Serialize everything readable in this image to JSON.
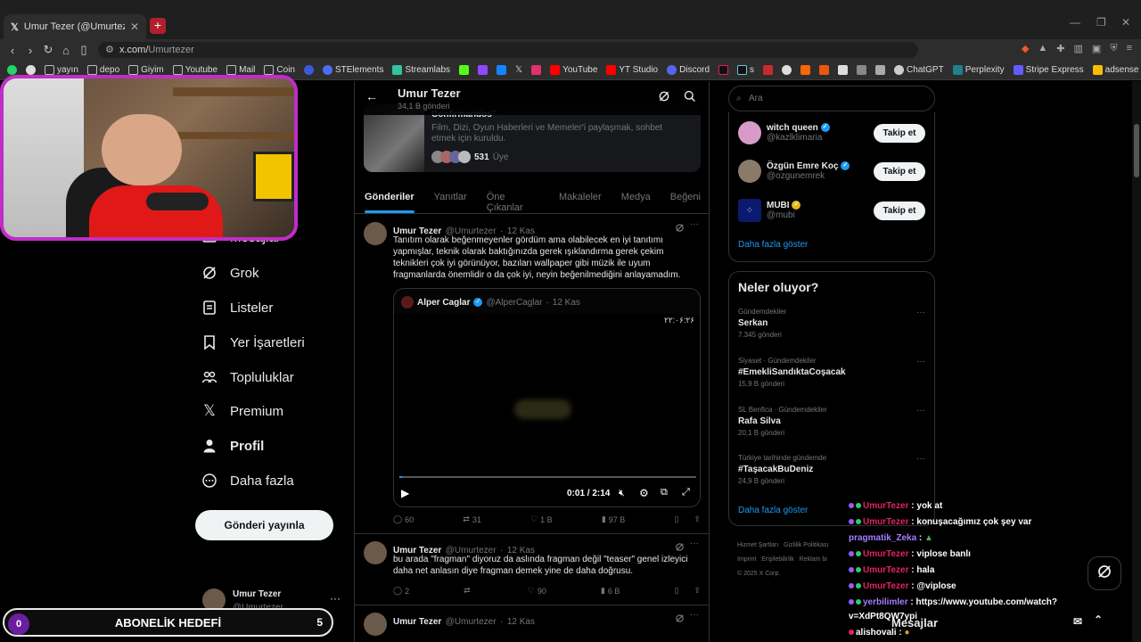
{
  "browser": {
    "tab_title": "Umur Tezer (@Umurtezer) / X",
    "url_prefix": "x.com/",
    "url_rest": "Umurtezer",
    "bookmarks": [
      "yayın",
      "depo",
      "Giyim",
      "Youtube",
      "Mail",
      "Coin",
      "STElements",
      "Streamlabs",
      "YouTube",
      "YT Studio",
      "Discord",
      "s",
      "ChatGPT",
      "Perplexity",
      "Stripe Express",
      "adsense"
    ],
    "colors": {
      "accent": "#1d9bf0",
      "webcam_border": "#c02dc8"
    }
  },
  "sidebar": {
    "items": [
      {
        "label": "Mesajlar",
        "icon": "envelope-icon"
      },
      {
        "label": "Grok",
        "icon": "grok-icon"
      },
      {
        "label": "Listeler",
        "icon": "list-icon"
      },
      {
        "label": "Yer İşaretleri",
        "icon": "bookmark-icon"
      },
      {
        "label": "Topluluklar",
        "icon": "people-icon"
      },
      {
        "label": "Premium",
        "icon": "x-logo-icon"
      },
      {
        "label": "Profil",
        "icon": "person-icon"
      },
      {
        "label": "Daha fazla",
        "icon": "more-circle-icon"
      }
    ],
    "post_button": "Gönderi yayınla",
    "account_name": "Umur Tezer",
    "account_handle": "@Umurtezer"
  },
  "profile_header": {
    "name": "Umur Tezer",
    "count": "34,1 B gönderi"
  },
  "community": {
    "title": "Confirmandos\"",
    "desc": "Film, Dizi, Oyun Haberleri ve Memeler'i paylaşmak, sohbet etmek için kuruldu.",
    "members_count": "531",
    "members_label": "Üye"
  },
  "tabs": [
    "Gönderiler",
    "Yanıtlar",
    "Öne Çıkanlar",
    "Makaleler",
    "Medya",
    "Beğeni"
  ],
  "tweets": [
    {
      "name": "Umur Tezer",
      "handle": "@Umurtezer",
      "date": "12 Kas",
      "text": "Tanıtım olarak beğenmeyenler gördüm ama olabilecek en iyi tanıtımı yapmışlar, teknik olarak baktığınızda gerek ışıklandırma gerek çekim teknikleri çok iyi görünüyor, bazıları wallpaper gibi müzik ile uyum fragmanlarda önemlidir o da çok iyi, neyin beğenilmediğini anlayamadım.",
      "quote": {
        "name": "Alper Caglar",
        "handle": "@AlperCaglar",
        "date": "12 Kas",
        "video_caption": "۲۲:۰۶:۲۶",
        "time": "0:01 / 2:14"
      },
      "replies": "60",
      "retweets": "31",
      "likes": "1 B",
      "views": "97 B"
    },
    {
      "name": "Umur Tezer",
      "handle": "@Umurtezer",
      "date": "12 Kas",
      "text": "bu arada \"fragman\" diyoruz da aslında fragman değil \"teaser\" genel izleyici daha net anlasın diye fragman demek yine de daha doğrusu.",
      "replies": "2",
      "retweets": "",
      "likes": "90",
      "views": "6 B"
    },
    {
      "name": "Umur Tezer",
      "handle": "@Umurtezer",
      "date": "12 Kas"
    }
  ],
  "search": {
    "placeholder": "Ara"
  },
  "who_to_follow": {
    "accounts": [
      {
        "name": "witch queen",
        "handle": "@kazlklimaria",
        "badge": "blue"
      },
      {
        "name": "Özgün Emre Koç",
        "handle": "@ozgunemrek",
        "badge": "blue"
      },
      {
        "name": "MUBI",
        "handle": "@mubi",
        "badge": "gold"
      }
    ],
    "follow_label": "Takip et",
    "show_more": "Daha fazla göster"
  },
  "trends": {
    "title": "Neler oluyor?",
    "items": [
      {
        "category": "Gündemdekiler",
        "topic": "Serkan",
        "count": "7.345 gönderi"
      },
      {
        "category": "Siyaset · Gündemdekiler",
        "topic": "#EmekliSandıktaCoşacak",
        "count": "15,9 B gönderi"
      },
      {
        "category": "SL Benfica · Gündemdekiler",
        "topic": "Rafa Silva",
        "count": "20,1 B gönderi"
      },
      {
        "category": "Türkiye tarihinde gündemde",
        "topic": "#TaşacakBuDeniz",
        "count": "24,9 B gönderi"
      }
    ],
    "show_more": "Daha fazla göster"
  },
  "footer": {
    "links": [
      "Hizmet Şartları",
      "Gizlilik Politikası",
      "Imprint",
      "Erişilebilirlik",
      "Reklam bi"
    ],
    "copyright": "© 2025 X Corp."
  },
  "goal": {
    "left": "0",
    "label": "ABONELİK HEDEFİ",
    "right": "5"
  },
  "chat": [
    {
      "user": "UmurTezer",
      "text": " : yok at"
    },
    {
      "user": "UmurTezer",
      "text": " : konuşacağımız çok şey var"
    },
    {
      "user": "pragmatik_Zeka",
      "text": " : "
    },
    {
      "user": "UmurTezer",
      "text": " : viplose banlı"
    },
    {
      "user": "UmurTezer",
      "text": " : hala"
    },
    {
      "user": "UmurTezer",
      "text": " : @viplose"
    },
    {
      "user": "yerbilimler",
      "text": " : https://www.youtube.com/watch?"
    },
    {
      "user": "",
      "text": "v=XdPt8QW7ypi"
    },
    {
      "user": "alishovali",
      "text": " : "
    }
  ],
  "messages": {
    "label": "Mesajlar"
  }
}
